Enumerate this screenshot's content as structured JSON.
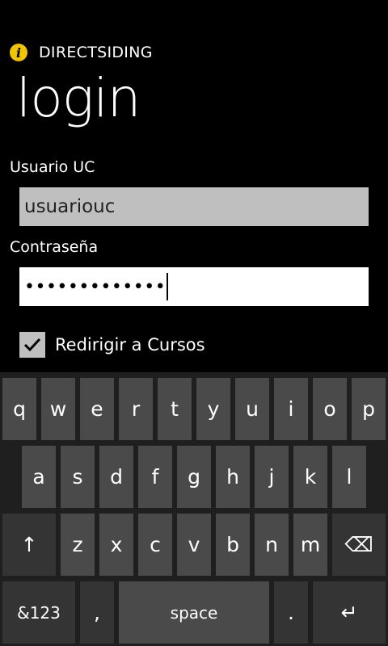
{
  "header": {
    "app_name": "DIRECTSIDING",
    "title": "login",
    "icon": "info-icon",
    "icon_color": "#f2c400"
  },
  "form": {
    "user_label": "Usuario UC",
    "user_value": "usuariouc",
    "password_label": "Contraseña",
    "password_value": "•••••••••••••",
    "checkbox_label": "Redirigir a Cursos",
    "checkbox_checked": true
  },
  "keyboard": {
    "row1": [
      "q",
      "w",
      "e",
      "r",
      "t",
      "y",
      "u",
      "i",
      "o",
      "p"
    ],
    "row2": [
      "a",
      "s",
      "d",
      "f",
      "g",
      "h",
      "j",
      "k",
      "l"
    ],
    "row3": [
      "z",
      "x",
      "c",
      "v",
      "b",
      "n",
      "m"
    ],
    "shift": "↑",
    "backspace": "⌫",
    "symbols": "&123",
    "comma": ",",
    "space": "space",
    "period": ".",
    "enter": "↵"
  }
}
